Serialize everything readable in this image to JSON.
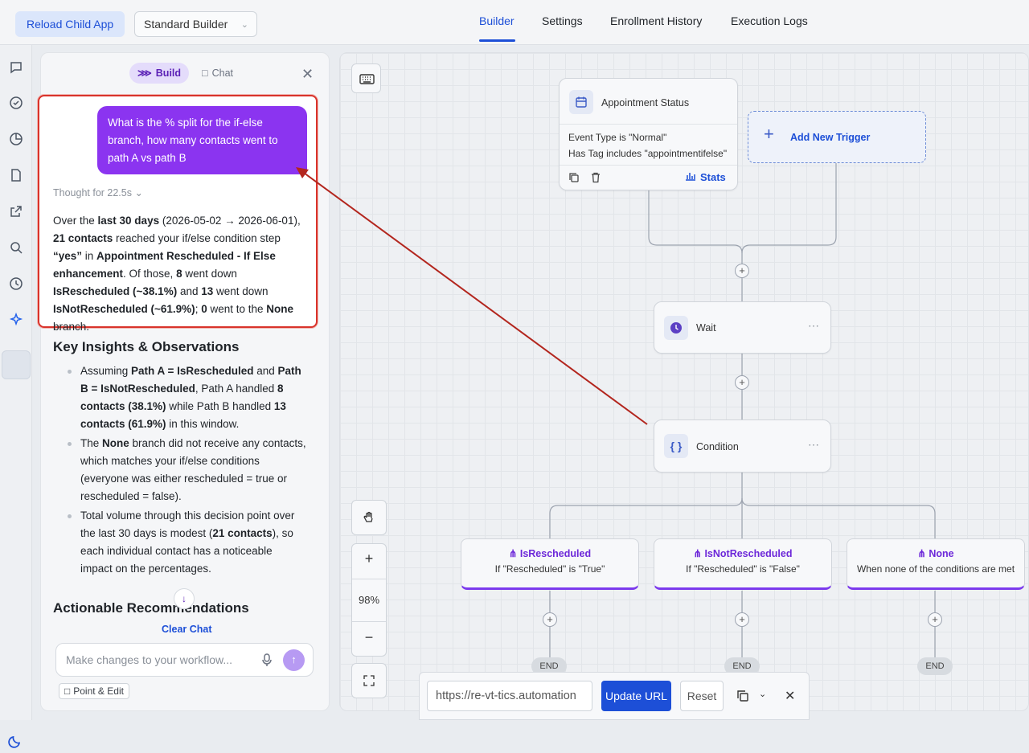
{
  "topbar": {
    "reload_label": "Reload Child App",
    "builder_select": "Standard Builder",
    "tabs": [
      "Builder",
      "Settings",
      "Enrollment History",
      "Execution Logs"
    ],
    "active_tab": "Builder"
  },
  "panel": {
    "mode_build": "Build",
    "mode_chat": "Chat",
    "user_message": "What is the % split for the if-else branch, how many contacts went to path A vs path B",
    "thought": "Thought for 22.5s",
    "answer": {
      "p1": "Over the ",
      "b1": "last 30 days",
      "p2": " (2026-05-02 → 2026-06-01), ",
      "b2": "21 contacts",
      "p3": " reached your if/else condition step ",
      "b3": "“yes”",
      "p4": " in ",
      "b4": "Appointment Rescheduled - If Else enhancement",
      "p5": ". Of those, ",
      "b5": "8",
      "p6": " went down ",
      "b6": "IsRescheduled (~38.1%)",
      "p7": " and ",
      "b7": "13",
      "p8": " went down ",
      "b8": "IsNotRescheduled (~61.9%)",
      "p9": "; ",
      "b9": "0",
      "p10": " went to the ",
      "b10": "None",
      "p11": " branch."
    },
    "insights_heading": "Key Insights & Observations",
    "insights": {
      "i1": {
        "p1": "Assuming ",
        "b1": "Path A = IsRescheduled",
        "p2": " and ",
        "b2": "Path B = IsNotRescheduled",
        "p3": ", Path A handled ",
        "b3": "8 contacts (38.1%)",
        "p4": " while Path B handled ",
        "b4": "13 contacts (61.9%)",
        "p5": " in this window."
      },
      "i2": {
        "p1": "The ",
        "b1": "None",
        "p2": " branch did not receive any contacts, which matches your if/else conditions (everyone was either rescheduled = true or rescheduled = false)."
      },
      "i3": {
        "p1": "Total volume through this decision point over the last 30 days is modest (",
        "b1": "21 contacts",
        "p2": "), so each individual contact has a noticeable impact on the percentages."
      }
    },
    "actions_heading": "Actionable Recommendations",
    "clear_chat": "Clear Chat",
    "composer_placeholder": "Make changes to your workflow...",
    "point_edit": "Point & Edit"
  },
  "canvas": {
    "trigger": {
      "title": "Appointment Status",
      "line1": "Event Type is \"Normal\"",
      "line2": "Has Tag includes \"appointmentifelse\"",
      "stats": "Stats"
    },
    "add_trigger": "Add New Trigger",
    "wait": "Wait",
    "condition": "Condition",
    "branches": [
      {
        "title": "IsRescheduled",
        "subtitle": "If \"Rescheduled\" is \"True\""
      },
      {
        "title": "IsNotRescheduled",
        "subtitle": "If \"Rescheduled\" is \"False\""
      },
      {
        "title": "None",
        "subtitle": "When none of the conditions are met"
      }
    ],
    "end_label": "END",
    "zoom": "98%"
  },
  "urlbar": {
    "url": "https://re-vt-tics.automation",
    "update": "Update URL",
    "reset": "Reset"
  },
  "colors": {
    "accent": "#1d4fd7",
    "purple": "#8b34f0",
    "highlight": "#d9332b"
  }
}
